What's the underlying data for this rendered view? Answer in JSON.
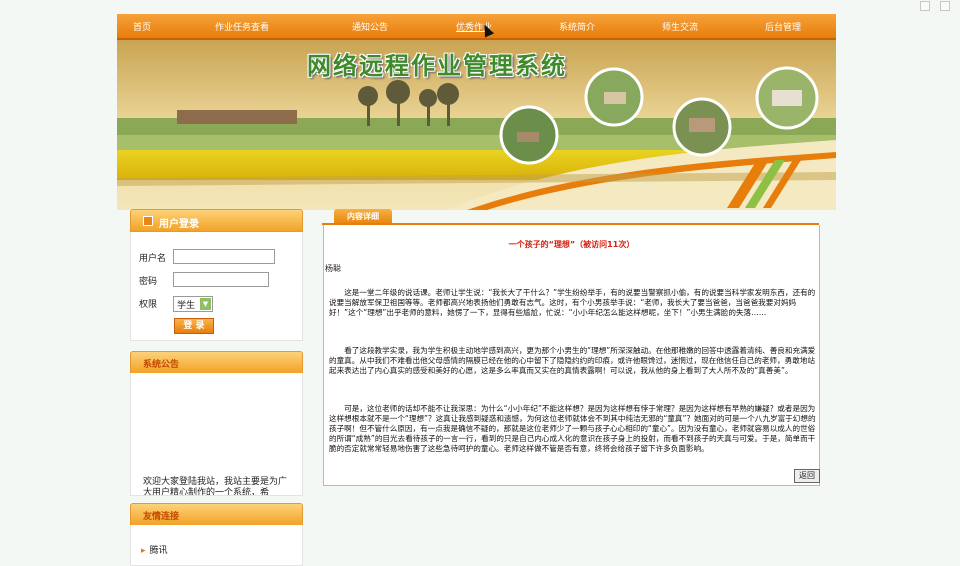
{
  "nav": {
    "items": [
      "首页",
      "作业任务查看",
      "通知公告",
      "优秀作业",
      "系统简介",
      "师生交流",
      "后台管理"
    ]
  },
  "site": {
    "title": "网络远程作业管理系统"
  },
  "login": {
    "title": "用户登录",
    "username_label": "用户名",
    "password_label": "密码",
    "role_label": "权限",
    "role_value": "学生",
    "submit_label": "登 录"
  },
  "notice": {
    "title": "系统公告",
    "text": "欢迎大家登陆我站，我站主要是为广大用户精心制作的一个系统，希"
  },
  "links": {
    "title": "友情连接",
    "items": [
      "腾讯"
    ]
  },
  "content": {
    "tab_label": "内容详细",
    "article_title": "一个孩子的“理想”（被访问11次）",
    "author": "杨聪",
    "paragraphs": [
      "这是一堂二年级的说话课。老师让学生说：“我长大了干什么？”学生纷纷举手，有的说要当警察抓小偷，有的说要当科学家发明东西，还有的说要当解放军保卫祖国等等。老师都高兴地表扬他们勇敢有志气。这时，有个小男孩举手说：“老师，我长大了要当爸爸，当爸爸我要对妈妈好！”这个“理想”出乎老师的意料，她愣了一下，显得有些尴尬，忙说：“小小年纪怎么能这样想呢，坐下！”小男生满脸的失落……",
      "看了这段教学实录，我为学生积极主动地学感到高兴，更为那个小男生的“理想”所深深触动。在他那稚嫩的回答中透露着清纯、善良和充满爱的童真。从中我们不难看出他父母感情的隔膜已经在他的心中留下了隐隐约约的印痕，或许他眼馋过，迷惘过，现在他信任自己的老师，勇敢地站起来表达出了内心真实的感受和美好的心愿，这是多么率真而又实在的真情表露啊！可以说，我从他的身上看到了大人所不及的“真善美”。",
      "可是，这位老师的话却不能不让我深思：为什么“小小年纪”不能这样想？是因为这样想有悖于常理？是因为这样想有早熟的嫌疑？或者是因为这样想根本就不是一个“理想”？这真让我感到疑惑和遗憾，为何这位老师就体会不到其中纯洁无邪的“童真”？她面对的可是一个八九岁富于幻想的孩子啊！但不管什么原因，有一点我是确信不疑的，那就是这位老师少了一颗与孩子心心相印的“童心”。因为没有童心，老师就容易以成人的世俗的所谓“成熟”的目光去看待孩子的一言一行，看到的只是自己内心成人化的意识在孩子身上的投射，而看不到孩子的天真与可爱。于是，简单而干脆的否定就常常轻易地伤害了这些急待呵护的童心。老师这样做不管是否有意，终将会给孩子留下许多负面影响。"
    ],
    "back_label": "返回"
  },
  "colors": {
    "accent": "#e77d0a",
    "title_red": "#d4210f",
    "title_green": "#3f8a2b"
  }
}
